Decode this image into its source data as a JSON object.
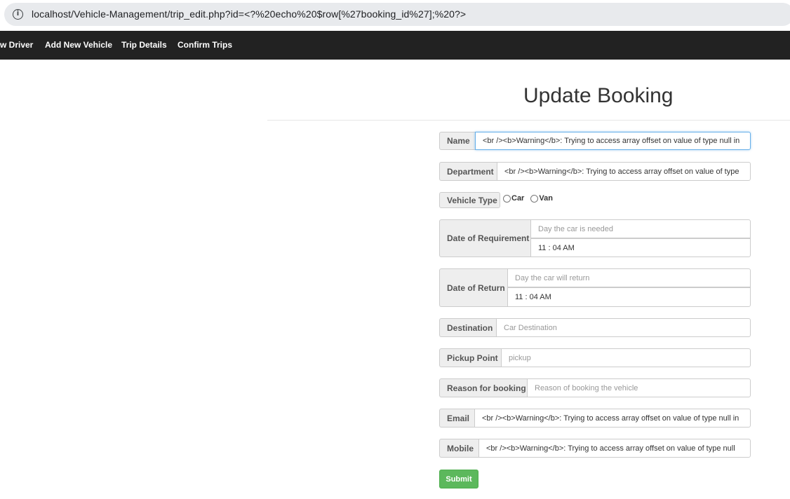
{
  "browser": {
    "url": "localhost/Vehicle-Management/trip_edit.php?id=<?%20echo%20$row[%27booking_id%27];%20?>"
  },
  "nav": {
    "items": [
      "w Driver",
      "Add New Vehicle",
      "Trip Details",
      "Confirm Trips"
    ]
  },
  "page": {
    "title": "Update Booking"
  },
  "form": {
    "name_label": "Name",
    "name_value": "<br /><b>Warning</b>:  Trying to access array offset on value of type null in",
    "department_label": "Department",
    "department_value": "<br /><b>Warning</b>:  Trying to access array offset on value of type",
    "vehicle_type_label": "Vehicle Type",
    "vehicle_options": [
      "Car",
      "Van"
    ],
    "requirement_label": "Date of Requirement",
    "requirement_date_placeholder": "Day the car is needed",
    "requirement_time": "11 : 04 AM",
    "return_label": "Date of Return",
    "return_date_placeholder": "Day the car will return",
    "return_time": "11 : 04 AM",
    "destination_label": "Destination",
    "destination_placeholder": "Car Destination",
    "pickup_label": "Pickup Point",
    "pickup_placeholder": "pickup",
    "reason_label": "Reason for booking",
    "reason_placeholder": "Reason of booking the vehicle",
    "email_label": "Email",
    "email_value": "<br /><b>Warning</b>:  Trying to access array offset on value of type null in",
    "mobile_label": "Mobile",
    "mobile_value": "<br /><b>Warning</b>:  Trying to access array offset on value of type null",
    "submit_label": "Submit"
  }
}
